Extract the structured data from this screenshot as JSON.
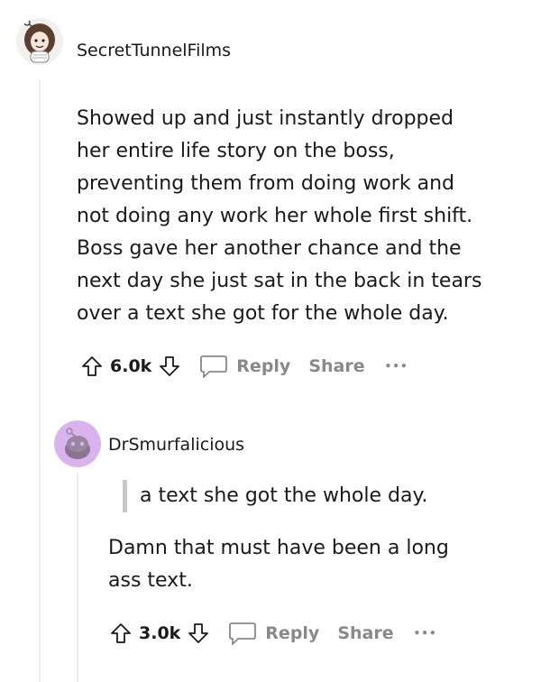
{
  "comment1": {
    "username": "SecretTunnelFilms",
    "avatar_icon": "snoo-avatar-icon",
    "body_lines": [
      "Showed up and just instantly dropped",
      "her entire life story on the boss,",
      "preventing them from doing work and",
      "not doing any work her whole first shift.",
      "Boss gave her another chance and the",
      "next day she just sat in the back in tears",
      "over a text she got for the whole day."
    ],
    "votes": "6.0k",
    "reply_label": "Reply",
    "share_label": "Share",
    "more_label": "•••"
  },
  "comment2": {
    "username": "DrSmurfalicious",
    "avatar_icon": "snoo-avatar-icon",
    "avatar_color": "#d9b3ee",
    "quote": "a text she got the whole day.",
    "body_lines": [
      "Damn that must have been a long",
      "ass text."
    ],
    "votes": "3.0k",
    "reply_label": "Reply",
    "share_label": "Share",
    "more_label": "•••"
  }
}
